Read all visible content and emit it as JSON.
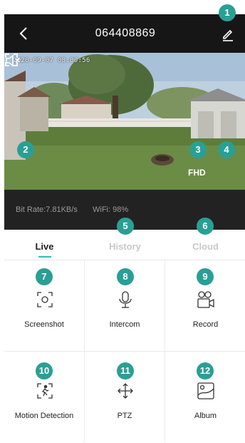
{
  "header": {
    "title": "064408869",
    "back_icon": "chevron-left-icon",
    "edit_icon": "pencil-icon"
  },
  "video": {
    "timestamp": "2020-09-07 08:00:56",
    "quality_label": "FHD"
  },
  "stats": {
    "bitrate": "Bit Rate:7.81KB/s",
    "wifi": "WiFi: 98%"
  },
  "tabs": [
    {
      "label": "Live",
      "active": true
    },
    {
      "label": "History",
      "active": false
    },
    {
      "label": "Cloud",
      "active": false
    }
  ],
  "features": [
    {
      "label": "Screenshot",
      "icon": "screenshot-icon"
    },
    {
      "label": "Intercom",
      "icon": "microphone-icon"
    },
    {
      "label": "Record",
      "icon": "video-camera-icon"
    },
    {
      "label": "Motion Detection",
      "icon": "motion-detection-icon"
    },
    {
      "label": "PTZ",
      "icon": "ptz-arrows-icon"
    },
    {
      "label": "Album",
      "icon": "album-icon"
    }
  ],
  "callouts": [
    "1",
    "2",
    "3",
    "4",
    "5",
    "6",
    "7",
    "8",
    "9",
    "10",
    "11",
    "12"
  ],
  "colors": {
    "accent": "#2fbfb2",
    "badge": "#2a9f95",
    "header_bg": "#161616",
    "stats_bg": "#222222"
  }
}
